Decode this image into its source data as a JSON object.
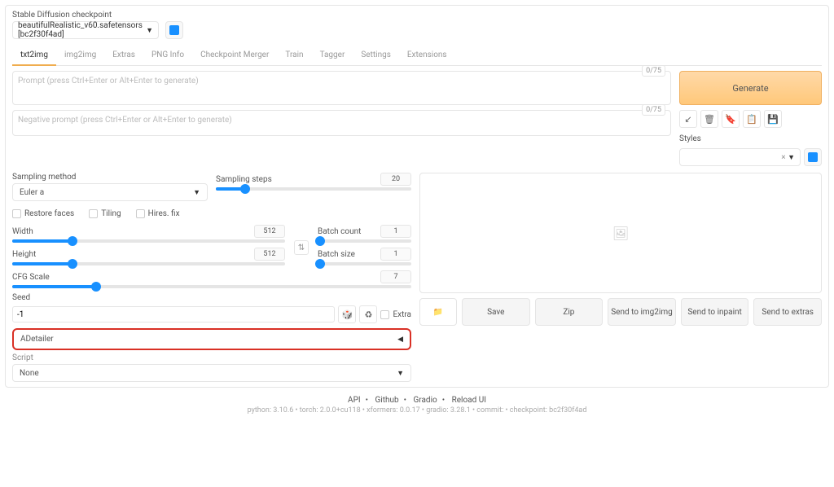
{
  "checkpoint_label": "Stable Diffusion checkpoint",
  "checkpoint_value": "beautifulRealistic_v60.safetensors [bc2f30f4ad]",
  "tabs": [
    "txt2img",
    "img2img",
    "Extras",
    "PNG Info",
    "Checkpoint Merger",
    "Train",
    "Tagger",
    "Settings",
    "Extensions"
  ],
  "prompt_placeholder": "Prompt (press Ctrl+Enter or Alt+Enter to generate)",
  "neg_placeholder": "Negative prompt (press Ctrl+Enter or Alt+Enter to generate)",
  "token_count": "0/75",
  "generate": "Generate",
  "styles_label": "Styles",
  "styles_clear": "×",
  "sampling_method_label": "Sampling method",
  "sampling_method_value": "Euler a",
  "sampling_steps_label": "Sampling steps",
  "sampling_steps_value": "20",
  "restore_faces": "Restore faces",
  "tiling": "Tiling",
  "hires_fix": "Hires. fix",
  "width_label": "Width",
  "width_value": "512",
  "height_label": "Height",
  "height_value": "512",
  "batch_count_label": "Batch count",
  "batch_count_value": "1",
  "batch_size_label": "Batch size",
  "batch_size_value": "1",
  "cfg_label": "CFG Scale",
  "cfg_value": "7",
  "seed_label": "Seed",
  "seed_value": "-1",
  "extra_label": "Extra",
  "adetailer": "ADetailer",
  "script_label": "Script",
  "script_value": "None",
  "actions": {
    "save": "Save",
    "zip": "Zip",
    "img2img": "Send to img2img",
    "inpaint": "Send to inpaint",
    "extras": "Send to extras"
  },
  "footer_links": [
    "API",
    "Github",
    "Gradio",
    "Reload UI"
  ],
  "footer_sub": "python: 3.10.6  •  torch: 2.0.0+cu118  •  xformers: 0.0.17  •  gradio: 3.28.1  •  commit:  •  checkpoint: bc2f30f4ad"
}
